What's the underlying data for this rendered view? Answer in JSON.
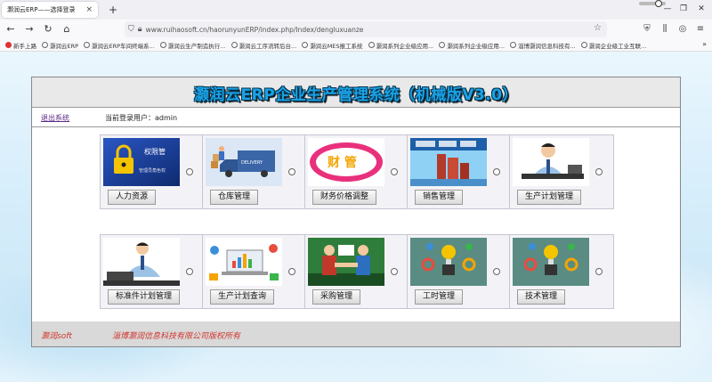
{
  "browser": {
    "tab_title": "灏润云ERP——选择登录",
    "tab_close": "×",
    "new_tab": "+",
    "url": "www.ruihaosoft.cn/haorunyunERP/index.php/Index/dengluxuanze",
    "bookmarks": [
      "新手上路",
      "灏润云ERP",
      "灏润云ERP车间终端系...",
      "灏润云生产制造执行...",
      "灏润云工序流转后台...",
      "灏润云MES报工系统",
      "灏润系列企业级应用...",
      "灏润系列企业级应用...",
      "淄博灏润信息科技有...",
      "灏润企业级工业互联..."
    ],
    "bookmarks_more": "»"
  },
  "app": {
    "title": "灏润云ERP企业生产管理系统（机械版V3.0）",
    "logout": "退出系统",
    "current_user": "当前登录用户：admin",
    "modules": [
      {
        "label": "人力资源",
        "icon": "padlock-hr-icon"
      },
      {
        "label": "仓库管理",
        "icon": "delivery-truck-icon"
      },
      {
        "label": "财务价格调整",
        "icon": "finance-banner-icon"
      },
      {
        "label": "销售管理",
        "icon": "sales-chart-icon"
      },
      {
        "label": "生产计划管理",
        "icon": "businessman-desk-icon"
      },
      {
        "label": "标准件计划管理",
        "icon": "businessman-laptop-icon"
      },
      {
        "label": "生产计划查询",
        "icon": "analytics-laptop-icon"
      },
      {
        "label": "采购管理",
        "icon": "handshake-icon"
      },
      {
        "label": "工时管理",
        "icon": "lightbulb-gears-icon"
      },
      {
        "label": "技术管理",
        "icon": "lightbulb-gears-icon"
      }
    ],
    "footer_brand": "灏润soft",
    "footer_copyright": "淄博灏润信息科技有限公司版权所有"
  },
  "module_images": {
    "hr_label": "权限管",
    "hr_sub": "管理员角色权",
    "warehouse_label": "DELIVERY",
    "finance_label": "财 管"
  }
}
